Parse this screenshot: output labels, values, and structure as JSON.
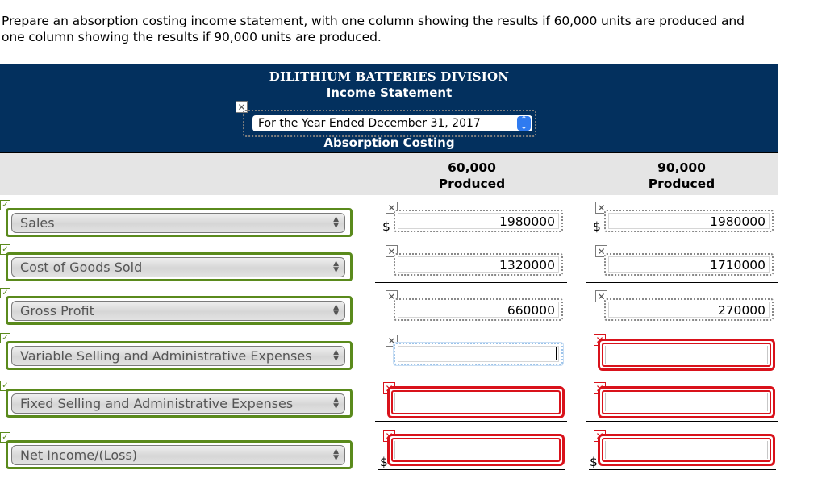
{
  "prompt": {
    "line1": "Prepare an absorption costing income statement, with one column showing the results if 60,000 units are produced and",
    "line2": "one column showing the results if 90,000 units are produced."
  },
  "header": {
    "company": "DILITHIUM BATTERIES DIVISION",
    "statement": "Income Statement",
    "period_select": "For the Year Ended December 31, 2017",
    "method": "Absorption Costing",
    "period_status_icon": "x-icon"
  },
  "columns": [
    {
      "units": "60,000",
      "label": "Produced"
    },
    {
      "units": "90,000",
      "label": "Produced"
    }
  ],
  "colors": {
    "header_bg": "#03305e",
    "correct_green": "#5a8a1c",
    "incorrect_red": "#d9121b",
    "focus_blue": "#9cc3ea"
  },
  "rows": [
    {
      "label": "Sales",
      "label_status": "correct",
      "col1": {
        "value": "1980000",
        "status": "neutral",
        "dollar": "$"
      },
      "col2": {
        "value": "1980000",
        "status": "neutral",
        "dollar": "$"
      }
    },
    {
      "label": "Cost of Goods Sold",
      "label_status": "correct",
      "col1": {
        "value": "1320000",
        "status": "neutral"
      },
      "col2": {
        "value": "1710000",
        "status": "neutral"
      }
    },
    {
      "label": "Gross Profit",
      "label_status": "correct",
      "col1": {
        "value": "660000",
        "status": "neutral"
      },
      "col2": {
        "value": "270000",
        "status": "neutral"
      }
    },
    {
      "label": "Variable Selling and Administrative Expenses",
      "label_status": "correct",
      "col1": {
        "value": "",
        "status": "focused"
      },
      "col2": {
        "value": "",
        "status": "incorrect"
      }
    },
    {
      "label": "Fixed Selling and Administrative Expenses",
      "label_status": "correct",
      "col1": {
        "value": "",
        "status": "incorrect"
      },
      "col2": {
        "value": "",
        "status": "incorrect"
      }
    },
    {
      "label": "Net Income/(Loss)",
      "label_status": "correct",
      "col1": {
        "value": "",
        "status": "incorrect",
        "dollar": "$"
      },
      "col2": {
        "value": "",
        "status": "incorrect",
        "dollar": "$"
      }
    }
  ],
  "icons": {
    "check": "✓",
    "x": "✕",
    "select_arrows": "▲▼",
    "date_arrows": "⌃⌄"
  }
}
